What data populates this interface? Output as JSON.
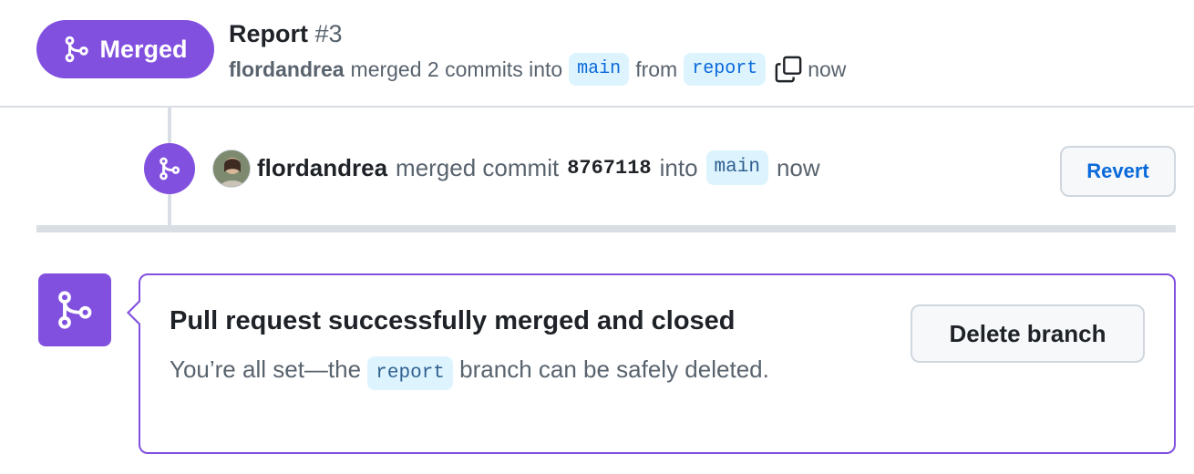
{
  "header": {
    "state_label": "Merged",
    "title": "Report",
    "number": "#3",
    "author": "flordandrea",
    "merged_text": "merged 2 commits into",
    "base_branch": "main",
    "from_text": "from",
    "head_branch": "report",
    "time": "now"
  },
  "event": {
    "author": "flordandrea",
    "merged_text": "merged commit",
    "sha": "8767118",
    "into_text": "into",
    "branch": "main",
    "time": "now",
    "revert_label": "Revert"
  },
  "merge_box": {
    "heading": "Pull request successfully merged and closed",
    "desc_before": "You’re all set—the",
    "branch": "report",
    "desc_after": "branch can be safely deleted.",
    "delete_label": "Delete branch"
  },
  "colors": {
    "merged_purple": "#8250df",
    "branch_bg": "#ddf4ff",
    "link_blue": "#0969da"
  },
  "icons": [
    "git-merge-icon",
    "copy-icon",
    "avatar"
  ]
}
